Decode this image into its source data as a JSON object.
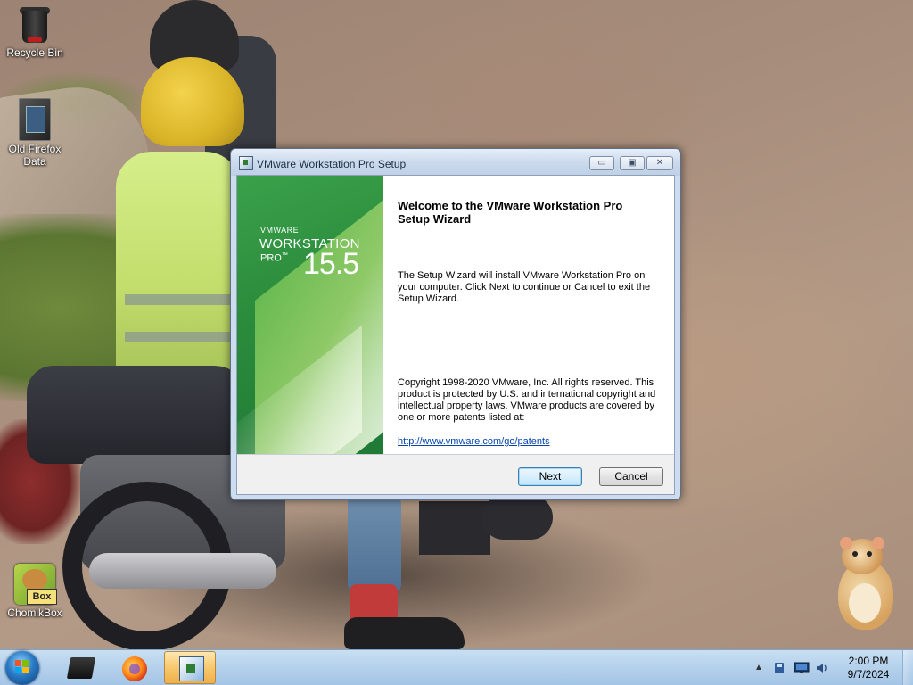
{
  "desktop": {
    "icons": {
      "recycle_bin": "Recycle Bin",
      "old_firefox_data_line1": "Old Firefox",
      "old_firefox_data_line2": "Data",
      "chomikbox": "ChomikBox",
      "chomikbox_badge": "Box"
    }
  },
  "window": {
    "title": "VMware Workstation Pro Setup",
    "controls": {
      "minimize": "▭",
      "maximize": "▣",
      "close": "✕"
    },
    "banner": {
      "vmware": "VMWARE",
      "product": "WORKSTATION",
      "edition": "PRO",
      "edition_mark": "™",
      "version": "15.5"
    },
    "welcome_heading": "Welcome to the VMware Workstation Pro Setup Wizard",
    "description": "The Setup Wizard will install VMware Workstation Pro on your computer. Click Next to continue or Cancel to exit the Setup Wizard.",
    "copyright": "Copyright 1998-2020 VMware, Inc. All rights reserved. This product is protected by U.S. and international copyright and intellectual property laws. VMware products are covered by one or more patents listed at:",
    "patents_link": "http://www.vmware.com/go/patents",
    "buttons": {
      "next": "Next",
      "cancel": "Cancel"
    }
  },
  "taskbar": {
    "items": [
      {
        "icon": "terminal-window-icon",
        "active": false
      },
      {
        "icon": "firefox-icon",
        "active": false
      },
      {
        "icon": "vmware-setup-icon",
        "active": true
      }
    ],
    "tray": {
      "arrow": "▲",
      "icons": [
        "hard-disk-icon",
        "network-monitor-icon",
        "volume-icon"
      ]
    },
    "clock": {
      "time": "2:00 PM",
      "date": "9/7/2024"
    }
  },
  "colors": {
    "banner_green": "#2b8b3c",
    "link_blue": "#0645ad",
    "taskbar": "#b6d2ec",
    "active_task": "#f7c86d"
  }
}
